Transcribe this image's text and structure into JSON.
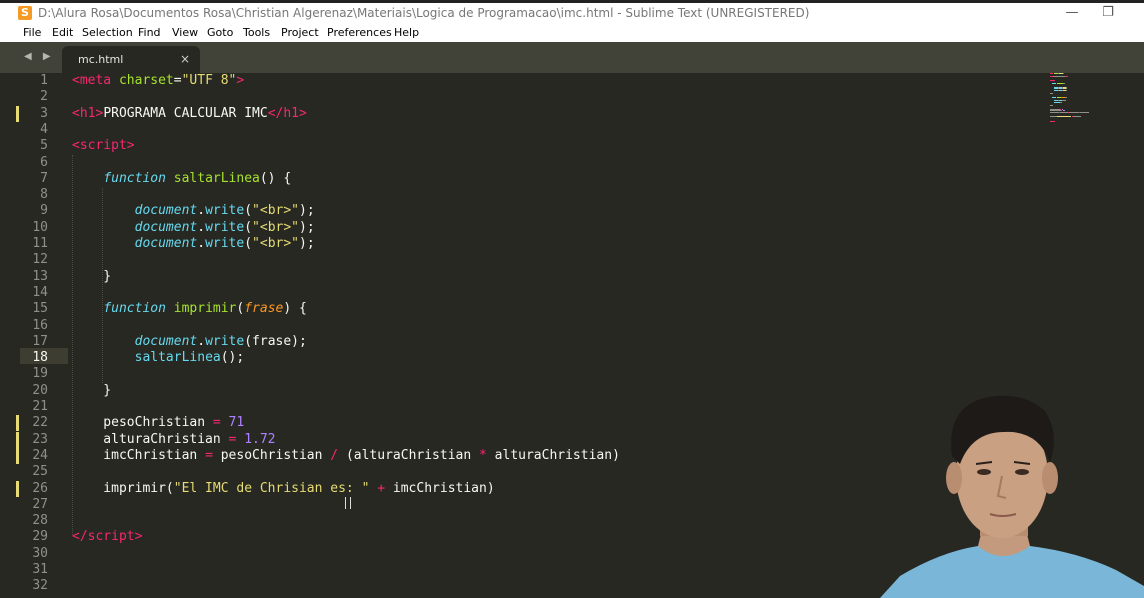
{
  "window": {
    "title": "D:\\Alura Rosa\\Documentos Rosa\\Christian Algerenaz\\Materiais\\Logica de Programacao\\imc.html - Sublime Text (UNREGISTERED)",
    "minimize_glyph": "—",
    "maximize_glyph": "❐"
  },
  "menu": [
    "File",
    "Edit",
    "Selection",
    "Find",
    "View",
    "Goto",
    "Tools",
    "Project",
    "Preferences",
    "Help"
  ],
  "tab": {
    "label": "mc.html",
    "close_glyph": "×"
  },
  "nav_arrows": "◀ ▶",
  "gutter": {
    "line_numbers": [
      "1",
      "2",
      "3",
      "4",
      "5",
      "6",
      "7",
      "8",
      "9",
      "10",
      "11",
      "12",
      "13",
      "14",
      "15",
      "16",
      "17",
      "18",
      "19",
      "20",
      "21",
      "22",
      "23",
      "24",
      "25",
      "26",
      "27",
      "28",
      "29",
      "30",
      "31",
      "32"
    ],
    "current_line": "18",
    "modified_lines": [
      "3",
      "22",
      "23",
      "24",
      "26"
    ]
  },
  "code_lines": [
    [
      [
        "tag",
        "<"
      ],
      [
        "tag",
        "meta"
      ],
      [
        "plain",
        " "
      ],
      [
        "attr",
        "charset"
      ],
      [
        "plain",
        "="
      ],
      [
        "str",
        "\"UTF 8\""
      ],
      [
        "tag",
        ">"
      ]
    ],
    [],
    [
      [
        "tag",
        "<"
      ],
      [
        "tag",
        "h1"
      ],
      [
        "tag",
        ">"
      ],
      [
        "plain",
        "PROGRAMA CALCULAR IMC"
      ],
      [
        "tag",
        "</"
      ],
      [
        "tag",
        "h1"
      ],
      [
        "tag",
        ">"
      ]
    ],
    [],
    [
      [
        "tag",
        "<"
      ],
      [
        "tag",
        "script"
      ],
      [
        "tag",
        ">"
      ]
    ],
    [],
    [
      [
        "plain",
        "    "
      ],
      [
        "kw",
        "function"
      ],
      [
        "plain",
        " "
      ],
      [
        "fn",
        "saltarLinea"
      ],
      [
        "plain",
        "() {"
      ]
    ],
    [],
    [
      [
        "plain",
        "        "
      ],
      [
        "obj",
        "document"
      ],
      [
        "plain",
        "."
      ],
      [
        "meth",
        "write"
      ],
      [
        "plain",
        "("
      ],
      [
        "str",
        "\"<br>\""
      ],
      [
        "plain",
        ");"
      ]
    ],
    [
      [
        "plain",
        "        "
      ],
      [
        "obj",
        "document"
      ],
      [
        "plain",
        "."
      ],
      [
        "meth",
        "write"
      ],
      [
        "plain",
        "("
      ],
      [
        "str",
        "\"<br>\""
      ],
      [
        "plain",
        ");"
      ]
    ],
    [
      [
        "plain",
        "        "
      ],
      [
        "obj",
        "document"
      ],
      [
        "plain",
        "."
      ],
      [
        "meth",
        "write"
      ],
      [
        "plain",
        "("
      ],
      [
        "str",
        "\"<br>\""
      ],
      [
        "plain",
        ");"
      ]
    ],
    [],
    [
      [
        "plain",
        "    }"
      ]
    ],
    [],
    [
      [
        "plain",
        "    "
      ],
      [
        "kw",
        "function"
      ],
      [
        "plain",
        " "
      ],
      [
        "fn",
        "imprimir"
      ],
      [
        "plain",
        "("
      ],
      [
        "param",
        "frase"
      ],
      [
        "plain",
        ") {"
      ]
    ],
    [],
    [
      [
        "plain",
        "        "
      ],
      [
        "obj",
        "document"
      ],
      [
        "plain",
        "."
      ],
      [
        "meth",
        "write"
      ],
      [
        "plain",
        "(frase);"
      ]
    ],
    [
      [
        "plain",
        "        "
      ],
      [
        "meth",
        "saltarLinea"
      ],
      [
        "plain",
        "();"
      ]
    ],
    [],
    [
      [
        "plain",
        "    }"
      ]
    ],
    [],
    [
      [
        "plain",
        "    pesoChristian "
      ],
      [
        "op",
        "="
      ],
      [
        "plain",
        " "
      ],
      [
        "num",
        "71"
      ]
    ],
    [
      [
        "plain",
        "    alturaChristian "
      ],
      [
        "op",
        "="
      ],
      [
        "plain",
        " "
      ],
      [
        "num",
        "1.72"
      ]
    ],
    [
      [
        "plain",
        "    imcChristian "
      ],
      [
        "op",
        "="
      ],
      [
        "plain",
        " pesoChristian "
      ],
      [
        "op",
        "/"
      ],
      [
        "plain",
        " (alturaChristian "
      ],
      [
        "op",
        "*"
      ],
      [
        "plain",
        " alturaChristian)"
      ]
    ],
    [],
    [
      [
        "plain",
        "    imprimir("
      ],
      [
        "str",
        "\"El IMC de Chrisian es: \""
      ],
      [
        "plain",
        " "
      ],
      [
        "op",
        "+"
      ],
      [
        "plain",
        " imcChristian)"
      ]
    ],
    [],
    [],
    [
      [
        "tag",
        "</"
      ],
      [
        "tag",
        "script"
      ],
      [
        "tag",
        ">"
      ]
    ],
    [],
    [],
    []
  ],
  "colors": {
    "background": "#272822",
    "tag": "#f92672",
    "attribute": "#a6e22e",
    "string": "#e6db74",
    "keyword": "#66d9ef",
    "number": "#ae81ff",
    "parameter": "#fd971f",
    "plain": "#f8f8f2",
    "modified_marker": "#e6db74"
  },
  "webcam": {
    "description_icon": "presenter-webcam"
  }
}
